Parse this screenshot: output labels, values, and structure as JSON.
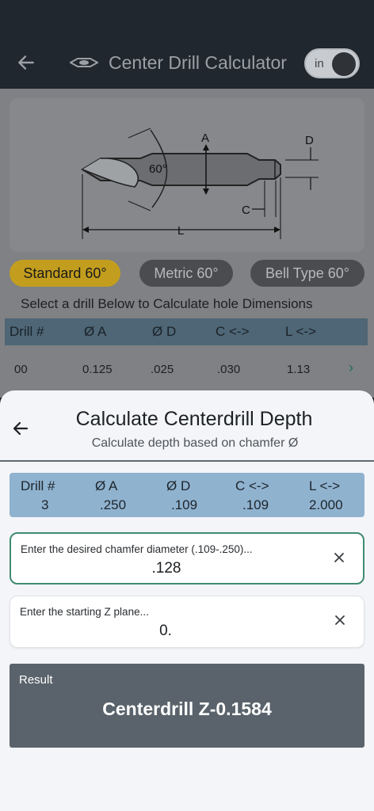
{
  "appbar": {
    "title": "Center Drill Calculator",
    "toggle_label": "in",
    "icons": {
      "back": "arrow-left-icon",
      "logo": "center-drill-logo-icon"
    }
  },
  "diagram": {
    "labels": {
      "a": "A",
      "d": "D",
      "angle": "60°",
      "c": "C",
      "l": "L"
    }
  },
  "tabs": [
    {
      "label": "Standard 60°",
      "selected": true
    },
    {
      "label": "Metric 60°",
      "selected": false
    },
    {
      "label": "Bell Type 60°",
      "selected": false
    }
  ],
  "instruction": "Select a drill Below to Calculate hole Dimensions",
  "table": {
    "headers": [
      "Drill #",
      "Ø A",
      "Ø D",
      "C <->",
      "L <->"
    ],
    "rows": [
      [
        "00",
        "0.125",
        ".025",
        ".030",
        "1.13"
      ]
    ]
  },
  "sheet": {
    "title": "Calculate Centerdrill Depth",
    "subtitle": "Calculate depth based on chamfer Ø",
    "selected_drill": {
      "headers": [
        "Drill #",
        "Ø A",
        "Ø D",
        "C <->",
        "L <->"
      ],
      "values": [
        "3",
        ".250",
        ".109",
        ".109",
        "2.000"
      ]
    },
    "chamfer_field": {
      "label": "Enter the desired chamfer diameter (.109-.250)...",
      "value": ".128"
    },
    "z_field": {
      "label": "Enter the starting Z plane...",
      "value": "0."
    },
    "result": {
      "label": "Result",
      "value": "Centerdrill Z-0.1584"
    }
  },
  "colors": {
    "accent": "#c39e1e",
    "focus_border": "#3f8a70",
    "info_bg": "#8fb2cf",
    "result_bg": "#5a636b"
  }
}
